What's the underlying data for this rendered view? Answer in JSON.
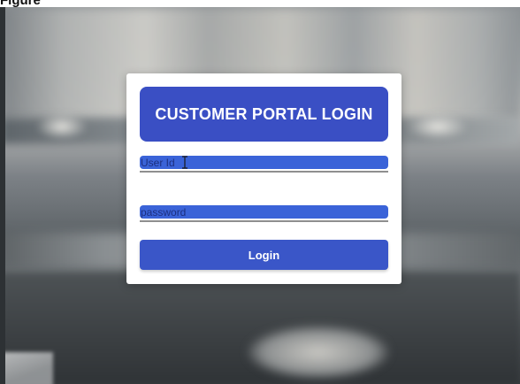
{
  "page": {
    "top_caption": "Figure"
  },
  "login_card": {
    "title": "CUSTOMER PORTAL LOGIN",
    "user_field": {
      "placeholder": "User Id",
      "value": ""
    },
    "password_field": {
      "placeholder": "password",
      "value": ""
    },
    "login_button_label": "Login"
  },
  "icons": {
    "cursor": "text-cursor-icon"
  },
  "colors": {
    "header_bg": "#3a4fc4",
    "input_bg": "#3a63d8",
    "button_bg": "#3a56c8",
    "card_bg": "#ffffff"
  }
}
